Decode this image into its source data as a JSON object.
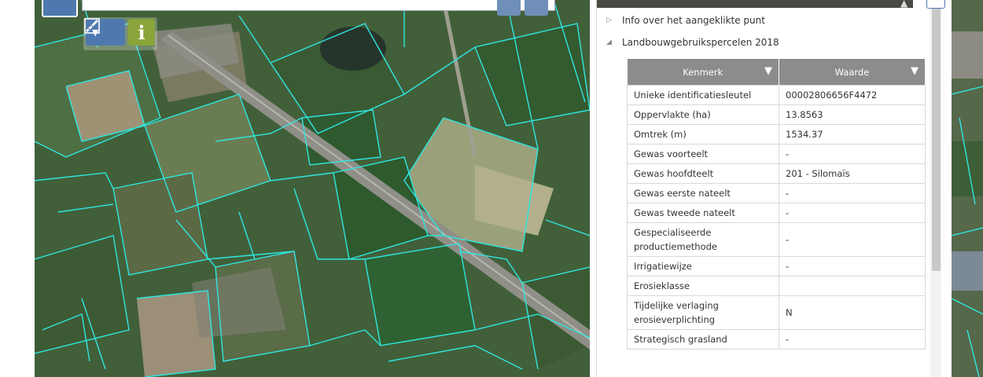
{
  "colors": {
    "parcel_outline": "#2fe6e0",
    "accent_blue": "#4f79ae",
    "info_green": "#8aa53a",
    "table_header": "#8c8c8c"
  },
  "map": {
    "tools": {
      "measure_icon": "ruler-pencil-icon",
      "dropdown_icon": "caret-down-icon",
      "info_label": "i"
    }
  },
  "panel": {
    "tree": [
      {
        "label": "Info over het aangeklikte punt",
        "expanded": false
      },
      {
        "label": "Landbouwgebruikspercelen 2018",
        "expanded": true
      }
    ],
    "table": {
      "headers": {
        "key": "Kenmerk",
        "value": "Waarde"
      },
      "rows": [
        {
          "key": "Unieke identificatiesleutel",
          "value": "00002806656F4472"
        },
        {
          "key": "Oppervlakte (ha)",
          "value": "13.8563"
        },
        {
          "key": "Omtrek (m)",
          "value": "1534.37"
        },
        {
          "key": "Gewas voorteelt",
          "value": "-"
        },
        {
          "key": "Gewas hoofdteelt",
          "value": "201 - Silomaïs"
        },
        {
          "key": "Gewas eerste nateelt",
          "value": "-"
        },
        {
          "key": "Gewas tweede nateelt",
          "value": "-"
        },
        {
          "key": "Gespecialiseerde productiemethode",
          "value": "-"
        },
        {
          "key": "Irrigatiewijze",
          "value": "-"
        },
        {
          "key": "Erosieklasse",
          "value": ""
        },
        {
          "key": "Tijdelijke verlaging erosieverplichting",
          "value": "N"
        },
        {
          "key": "Strategisch grasland",
          "value": "-"
        }
      ]
    }
  }
}
